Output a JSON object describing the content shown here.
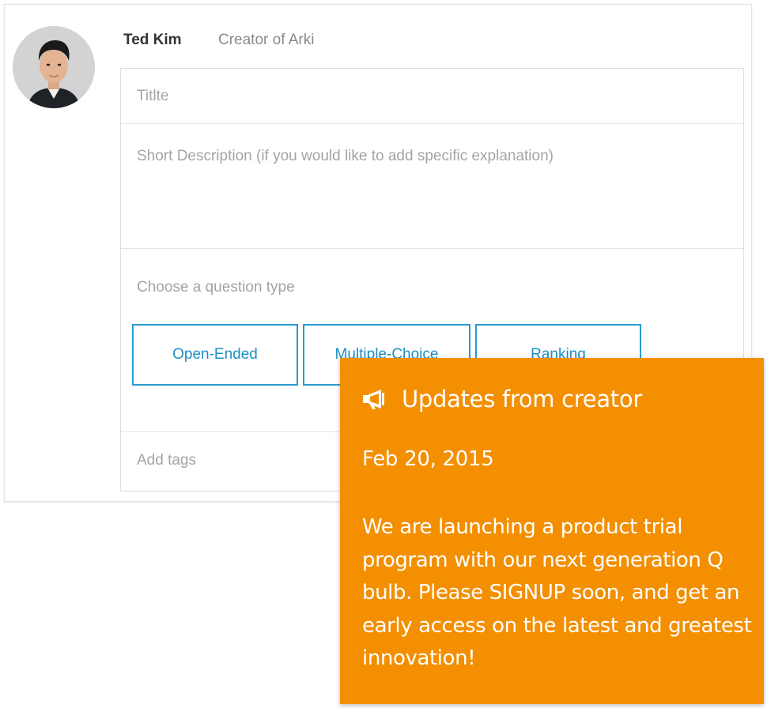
{
  "author": {
    "name": "Ted Kim",
    "role": "Creator of Arki"
  },
  "form": {
    "title_placeholder": "Titlte",
    "description_placeholder": "Short Description (if you would like to add specific explanation)",
    "question_type_label": "Choose a question type",
    "question_types": [
      "Open-Ended",
      "Multiple-Choice",
      "Ranking"
    ],
    "tags_placeholder": "Add tags"
  },
  "popup": {
    "icon": "megaphone-icon",
    "title": "Updates from creator",
    "date": "Feb 20, 2015",
    "message": "We are launching a product trial program with our next generation Q bulb. Please SIGNUP soon, and get an early access on the latest and greatest innovation!",
    "background_color": "#f38f00"
  },
  "colors": {
    "accent": "#2a9bd0",
    "placeholder": "#a4a4a4"
  }
}
